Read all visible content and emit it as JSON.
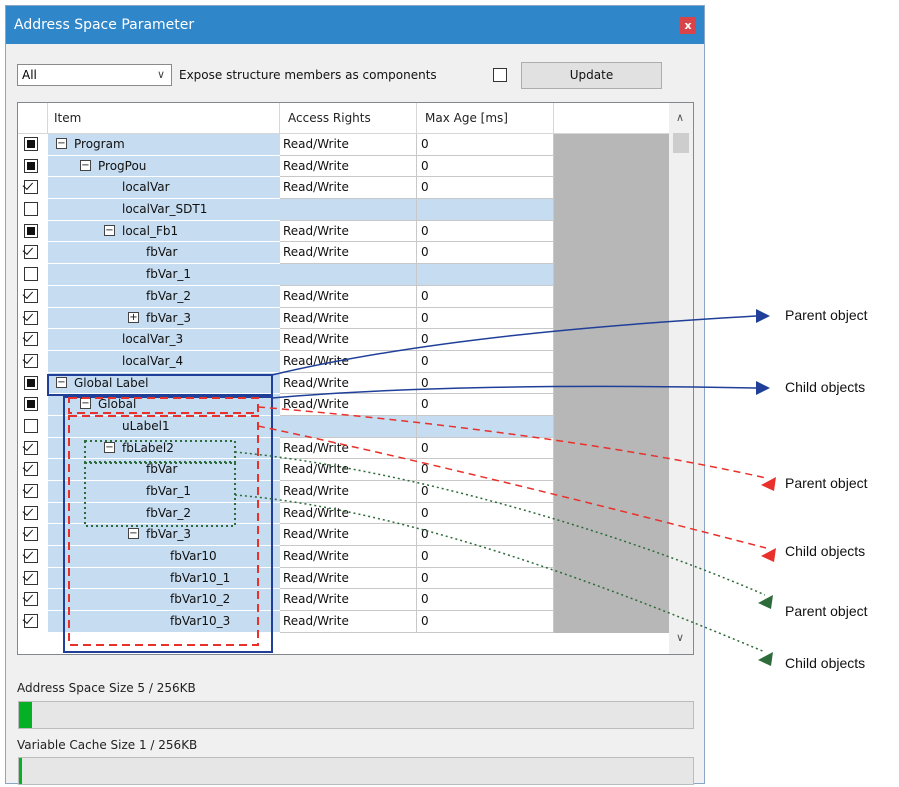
{
  "window": {
    "title": "Address Space Parameter",
    "close_label": "x"
  },
  "toolbar": {
    "filter_value": "All",
    "expose_label": "Expose structure members as components",
    "update_label": "Update"
  },
  "grid": {
    "headers": {
      "item": "Item",
      "access": "Access Rights",
      "age": "Max Age [ms]"
    },
    "rows": [
      {
        "label": "Program",
        "level": 0,
        "check": "partial",
        "expander": "minus",
        "access": "Read/Write",
        "age": "0"
      },
      {
        "label": "ProgPou",
        "level": 1,
        "check": "partial",
        "expander": "minus",
        "access": "Read/Write",
        "age": "0"
      },
      {
        "label": "localVar",
        "level": 2,
        "check": "checked",
        "expander": "",
        "access": "Read/Write",
        "age": "0"
      },
      {
        "label": "localVar_SDT1",
        "level": 2,
        "check": "unchecked",
        "expander": "",
        "access": "",
        "age": ""
      },
      {
        "label": "local_Fb1",
        "level": 2,
        "check": "partial",
        "expander": "minus",
        "access": "Read/Write",
        "age": "0"
      },
      {
        "label": "fbVar",
        "level": 3,
        "check": "checked",
        "expander": "",
        "access": "Read/Write",
        "age": "0"
      },
      {
        "label": "fbVar_1",
        "level": 3,
        "check": "unchecked",
        "expander": "",
        "access": "",
        "age": ""
      },
      {
        "label": "fbVar_2",
        "level": 3,
        "check": "checked",
        "expander": "",
        "access": "Read/Write",
        "age": "0"
      },
      {
        "label": "fbVar_3",
        "level": 3,
        "check": "checked",
        "expander": "plus",
        "access": "Read/Write",
        "age": "0"
      },
      {
        "label": "localVar_3",
        "level": 2,
        "check": "checked",
        "expander": "",
        "access": "Read/Write",
        "age": "0"
      },
      {
        "label": "localVar_4",
        "level": 2,
        "check": "checked",
        "expander": "",
        "access": "Read/Write",
        "age": "0"
      },
      {
        "label": "Global Label",
        "level": 0,
        "check": "partial",
        "expander": "minus",
        "access": "Read/Write",
        "age": "0"
      },
      {
        "label": "Global",
        "level": 1,
        "check": "partial",
        "expander": "minus",
        "access": "Read/Write",
        "age": "0"
      },
      {
        "label": "uLabel1",
        "level": 2,
        "check": "unchecked",
        "expander": "",
        "access": "",
        "age": ""
      },
      {
        "label": "fbLabel2",
        "level": 2,
        "check": "checked",
        "expander": "minus",
        "access": "Read/Write",
        "age": "0"
      },
      {
        "label": "fbVar",
        "level": 3,
        "check": "checked",
        "expander": "",
        "access": "Read/Write",
        "age": "0"
      },
      {
        "label": "fbVar_1",
        "level": 3,
        "check": "checked",
        "expander": "",
        "access": "Read/Write",
        "age": "0"
      },
      {
        "label": "fbVar_2",
        "level": 3,
        "check": "checked",
        "expander": "",
        "access": "Read/Write",
        "age": "0"
      },
      {
        "label": "fbVar_3",
        "level": 3,
        "check": "checked",
        "expander": "minus",
        "access": "Read/Write",
        "age": "0"
      },
      {
        "label": "fbVar10",
        "level": 4,
        "check": "checked",
        "expander": "",
        "access": "Read/Write",
        "age": "0"
      },
      {
        "label": "fbVar10_1",
        "level": 4,
        "check": "checked",
        "expander": "",
        "access": "Read/Write",
        "age": "0"
      },
      {
        "label": "fbVar10_2",
        "level": 4,
        "check": "checked",
        "expander": "",
        "access": "Read/Write",
        "age": "0"
      },
      {
        "label": "fbVar10_3",
        "level": 4,
        "check": "checked",
        "expander": "",
        "access": "Read/Write",
        "age": "0"
      }
    ]
  },
  "footer": {
    "address_space_label": "Address Space Size 5 / 256KB",
    "address_space_fraction": 0.0195,
    "cache_label": "Variable Cache Size 1 / 256KB",
    "cache_fraction": 0.0039
  },
  "annotations": {
    "blue_parent": "Parent object",
    "blue_child": "Child objects",
    "red_parent": "Parent object",
    "red_child": "Child objects",
    "green_parent": "Parent object",
    "green_child": "Child objects"
  },
  "colors": {
    "titlebar": "#2f86c8",
    "selection": "#c6dcf1",
    "blue": "#1f3f99",
    "red": "#e8312b",
    "green": "#2d6b3a",
    "progress": "#06b025"
  }
}
